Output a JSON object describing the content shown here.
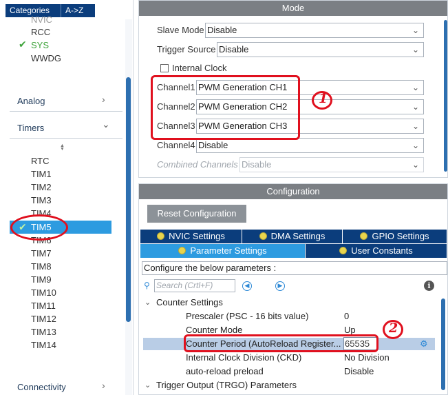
{
  "left": {
    "tabs": [
      "Categories",
      "A->Z"
    ],
    "system_items": [
      {
        "label": "NVIC",
        "checked": false
      },
      {
        "label": "RCC",
        "checked": false
      },
      {
        "label": "SYS",
        "checked": true
      },
      {
        "label": "WWDG",
        "checked": false
      }
    ],
    "categories": {
      "analog": "Analog",
      "timers": "Timers",
      "connectivity": "Connectivity"
    },
    "timers": [
      "RTC",
      "TIM1",
      "TIM2",
      "TIM3",
      "TIM4",
      "TIM5",
      "TIM6",
      "TIM7",
      "TIM8",
      "TIM9",
      "TIM10",
      "TIM11",
      "TIM12",
      "TIM13",
      "TIM14"
    ],
    "selected_timer": "TIM5",
    "check_glyph": "✔",
    "chevron_right": "›",
    "chevron_down": "⌄",
    "sort_glyph": "▲▼"
  },
  "mode": {
    "header": "Mode",
    "slave_mode": {
      "label": "Slave Mode",
      "value": "Disable"
    },
    "trigger_source": {
      "label": "Trigger Source",
      "value": "Disable"
    },
    "internal_clock": {
      "label": "Internal Clock",
      "checked": false
    },
    "channels": [
      {
        "label": "Channel1",
        "value": "PWM Generation CH1"
      },
      {
        "label": "Channel2",
        "value": "PWM Generation CH2"
      },
      {
        "label": "Channel3",
        "value": "PWM Generation CH3"
      },
      {
        "label": "Channel4",
        "value": "Disable"
      }
    ],
    "combined_channels": {
      "label": "Combined Channels",
      "value": "Disable"
    },
    "annotation": "1"
  },
  "config": {
    "header": "Configuration",
    "reset_button": "Reset Configuration",
    "tabs_row1": [
      "NVIC Settings",
      "DMA Settings",
      "GPIO Settings"
    ],
    "tabs_row2": [
      "Parameter Settings",
      "User Constants"
    ],
    "active_tab": "Parameter Settings",
    "description": "Configure the below parameters :",
    "search_placeholder": "Search (Crtl+F)",
    "info_glyph": "i",
    "prev_glyph": "◀",
    "next_glyph": "▶",
    "groups": {
      "counter_settings": "Counter Settings",
      "trigger_output": "Trigger Output (TRGO) Parameters"
    },
    "params": [
      {
        "name": "Prescaler (PSC - 16 bits value)",
        "value": "0"
      },
      {
        "name": "Counter Mode",
        "value": "Up"
      },
      {
        "name": "Counter Period (AutoReload Register...",
        "value": "65535"
      },
      {
        "name": "Internal Clock Division (CKD)",
        "value": "No Division"
      },
      {
        "name": "auto-reload preload",
        "value": "Disable"
      }
    ],
    "annotation": "2"
  },
  "colors": {
    "accent_dark": "#0b3d7c",
    "accent_light": "#2d9be0",
    "annotation_red": "#e0101e"
  }
}
